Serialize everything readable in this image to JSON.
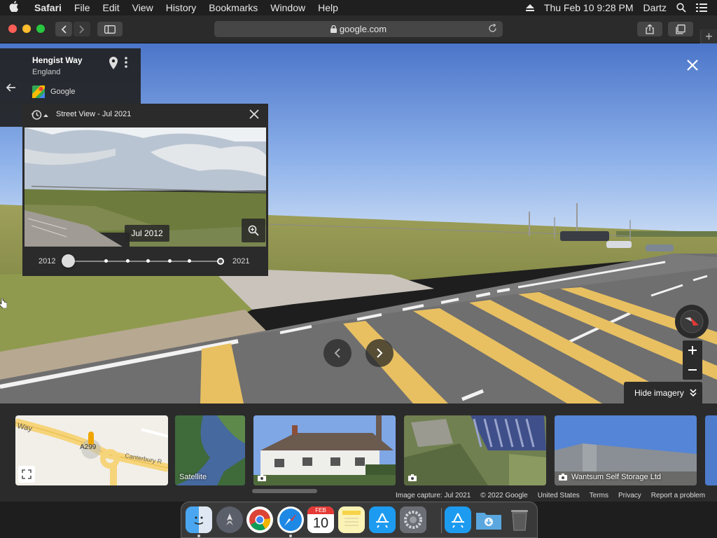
{
  "menubar": {
    "app": "Safari",
    "items": [
      "File",
      "Edit",
      "View",
      "History",
      "Bookmarks",
      "Window",
      "Help"
    ],
    "datetime": "Thu Feb 10  9:28 PM",
    "user": "Dartz"
  },
  "toolbar": {
    "url": "google.com"
  },
  "place": {
    "name": "Hengist Way",
    "region": "England",
    "provider": "Google"
  },
  "time_travel": {
    "title": "Street View - Jul 2021",
    "selected_date": "Jul 2012",
    "start_year": "2012",
    "end_year": "2021",
    "slider_position": 0
  },
  "controls": {
    "hide_imagery": "Hide imagery"
  },
  "thumbnails": [
    {
      "kind": "map",
      "label": "",
      "map_text_a": "Way",
      "map_text_b": "Canterbury R",
      "map_road": "A299"
    },
    {
      "kind": "satellite",
      "label": "Satellite"
    },
    {
      "kind": "photo",
      "label": ""
    },
    {
      "kind": "photo",
      "label": ""
    },
    {
      "kind": "photo",
      "label": "Wantsum Self Storage Ltd"
    }
  ],
  "footer": {
    "capture": "Image capture: Jul 2021",
    "copyright": "© 2022 Google",
    "country": "United States",
    "terms": "Terms",
    "privacy": "Privacy",
    "report": "Report a problem"
  },
  "dock": {
    "calendar_month": "FEB",
    "calendar_day": "10"
  },
  "colors": {
    "road_line_yellow": "#e8c061",
    "panel_bg": "#2b2b2b",
    "sky_blue": "#7fa7e6"
  }
}
